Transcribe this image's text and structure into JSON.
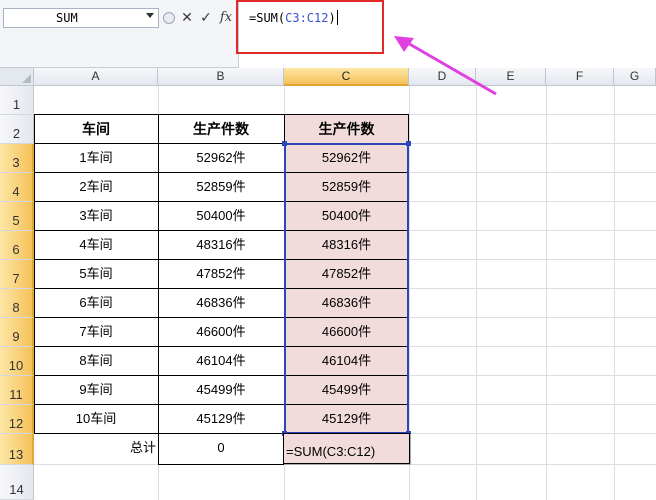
{
  "namebox": {
    "value": "SUM"
  },
  "formula_bar": {
    "cancel_icon": "✕",
    "enter_icon": "✓",
    "fx_label": "fx",
    "formula_prefix": "=SUM(",
    "formula_ref": "C3:C12",
    "formula_suffix": ")"
  },
  "columns": [
    "A",
    "B",
    "C",
    "D",
    "E",
    "F",
    "G"
  ],
  "rows": [
    "1",
    "2",
    "3",
    "4",
    "5",
    "6",
    "7",
    "8",
    "9",
    "10",
    "11",
    "12",
    "13",
    "14"
  ],
  "table": {
    "header": {
      "a": "车间",
      "b": "生产件数",
      "c": "生产件数"
    },
    "rows": [
      {
        "a": "1车间",
        "b": "52962件",
        "c": "52962件"
      },
      {
        "a": "2车间",
        "b": "52859件",
        "c": "52859件"
      },
      {
        "a": "3车间",
        "b": "50400件",
        "c": "50400件"
      },
      {
        "a": "4车间",
        "b": "48316件",
        "c": "48316件"
      },
      {
        "a": "5车间",
        "b": "47852件",
        "c": "47852件"
      },
      {
        "a": "6车间",
        "b": "46836件",
        "c": "46836件"
      },
      {
        "a": "7车间",
        "b": "46600件",
        "c": "46600件"
      },
      {
        "a": "8车间",
        "b": "46104件",
        "c": "46104件"
      },
      {
        "a": "9车间",
        "b": "45499件",
        "c": "45499件"
      },
      {
        "a": "10车间",
        "b": "45129件",
        "c": "45129件"
      }
    ],
    "total": {
      "label": "总计",
      "b": "0",
      "c": "=SUM(C3:C12)"
    }
  },
  "colors": {
    "highlight_box": "#e02a2a",
    "arrow": "#e040e0",
    "selection": "#2a46b8",
    "pink_fill": "#f2dcdb"
  }
}
